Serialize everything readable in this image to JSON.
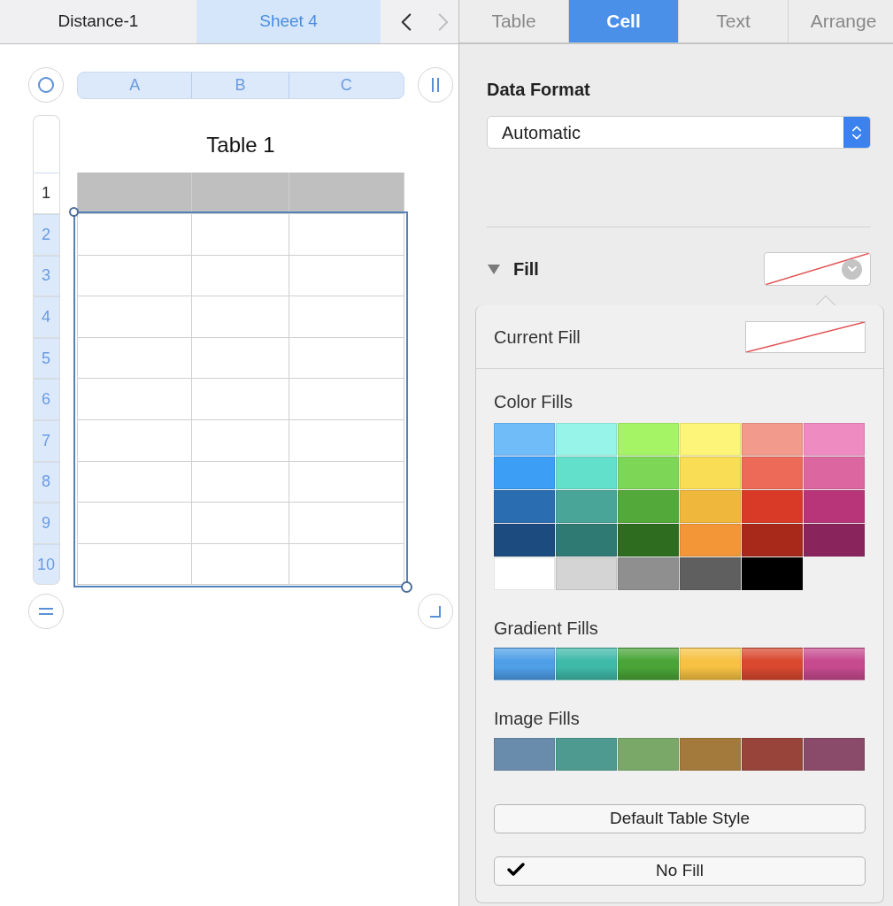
{
  "sheet_tabs": [
    {
      "label": "Distance-1",
      "selected": false
    },
    {
      "label": "Sheet 4",
      "selected": true
    }
  ],
  "sheet_nav": {
    "prev_disabled": false,
    "next_disabled": true
  },
  "table": {
    "title": "Table 1",
    "column_headers": [
      {
        "label": "A",
        "selected": true
      },
      {
        "label": "B",
        "selected": true
      },
      {
        "label": "C",
        "selected": true
      }
    ],
    "row_headers": [
      {
        "label": "1",
        "selected": false
      },
      {
        "label": "2",
        "selected": true
      },
      {
        "label": "3",
        "selected": true
      },
      {
        "label": "4",
        "selected": true
      },
      {
        "label": "5",
        "selected": true
      },
      {
        "label": "6",
        "selected": true
      },
      {
        "label": "7",
        "selected": true
      },
      {
        "label": "8",
        "selected": true
      },
      {
        "label": "9",
        "selected": true
      },
      {
        "label": "10",
        "selected": true
      }
    ]
  },
  "inspector_tabs": [
    {
      "label": "Table",
      "selected": false
    },
    {
      "label": "Cell",
      "selected": true
    },
    {
      "label": "Text",
      "selected": false
    },
    {
      "label": "Arrange",
      "selected": false
    }
  ],
  "data_format": {
    "label": "Data Format",
    "value": "Automatic"
  },
  "fill": {
    "label": "Fill",
    "expanded": true
  },
  "fill_popover": {
    "current_fill_label": "Current Fill",
    "color_fills": {
      "label": "Color Fills",
      "swatches": [
        {
          "color": "#6fbcf9"
        },
        {
          "color": "#96f5e8"
        },
        {
          "color": "#a5f466"
        },
        {
          "color": "#fdf57a"
        },
        {
          "color": "#f29a8c"
        },
        {
          "color": "#ee8cc1"
        },
        {
          "color": "#3c9ff5"
        },
        {
          "color": "#63e0cc"
        },
        {
          "color": "#7ed657"
        },
        {
          "color": "#f8dd55"
        },
        {
          "color": "#ec6a57"
        },
        {
          "color": "#dc66a0"
        },
        {
          "color": "#2a6db0"
        },
        {
          "color": "#48a598"
        },
        {
          "color": "#53a93a"
        },
        {
          "color": "#f0b73d"
        },
        {
          "color": "#d93a27"
        },
        {
          "color": "#b8357a"
        },
        {
          "color": "#1c4b7f"
        },
        {
          "color": "#2f7a72"
        },
        {
          "color": "#2e6c20"
        },
        {
          "color": "#f29638"
        },
        {
          "color": "#a8291a"
        },
        {
          "color": "#8a245d"
        },
        {
          "color": "#ffffff"
        },
        {
          "color": "#d4d4d4"
        },
        {
          "color": "#8f8f8f"
        },
        {
          "color": "#5f5f5f"
        },
        {
          "color": "#000000"
        }
      ]
    },
    "gradient_fills": {
      "label": "Gradient Fills",
      "swatches": [
        {
          "color": "#4e9fe8"
        },
        {
          "color": "#3fb9a8"
        },
        {
          "color": "#4aa437"
        },
        {
          "color": "#f7c243"
        },
        {
          "color": "#d9482f"
        },
        {
          "color": "#c64a8e"
        }
      ]
    },
    "image_fills": {
      "label": "Image Fills",
      "swatches": [
        {
          "color": "#6a8cac"
        },
        {
          "color": "#4f9a90"
        },
        {
          "color": "#7aa868"
        },
        {
          "color": "#a47a3c"
        },
        {
          "color": "#98443a"
        },
        {
          "color": "#8a4a6a"
        }
      ]
    },
    "buttons": [
      {
        "label": "Default Table Style",
        "checked": false
      },
      {
        "label": "No Fill",
        "checked": true
      }
    ]
  }
}
